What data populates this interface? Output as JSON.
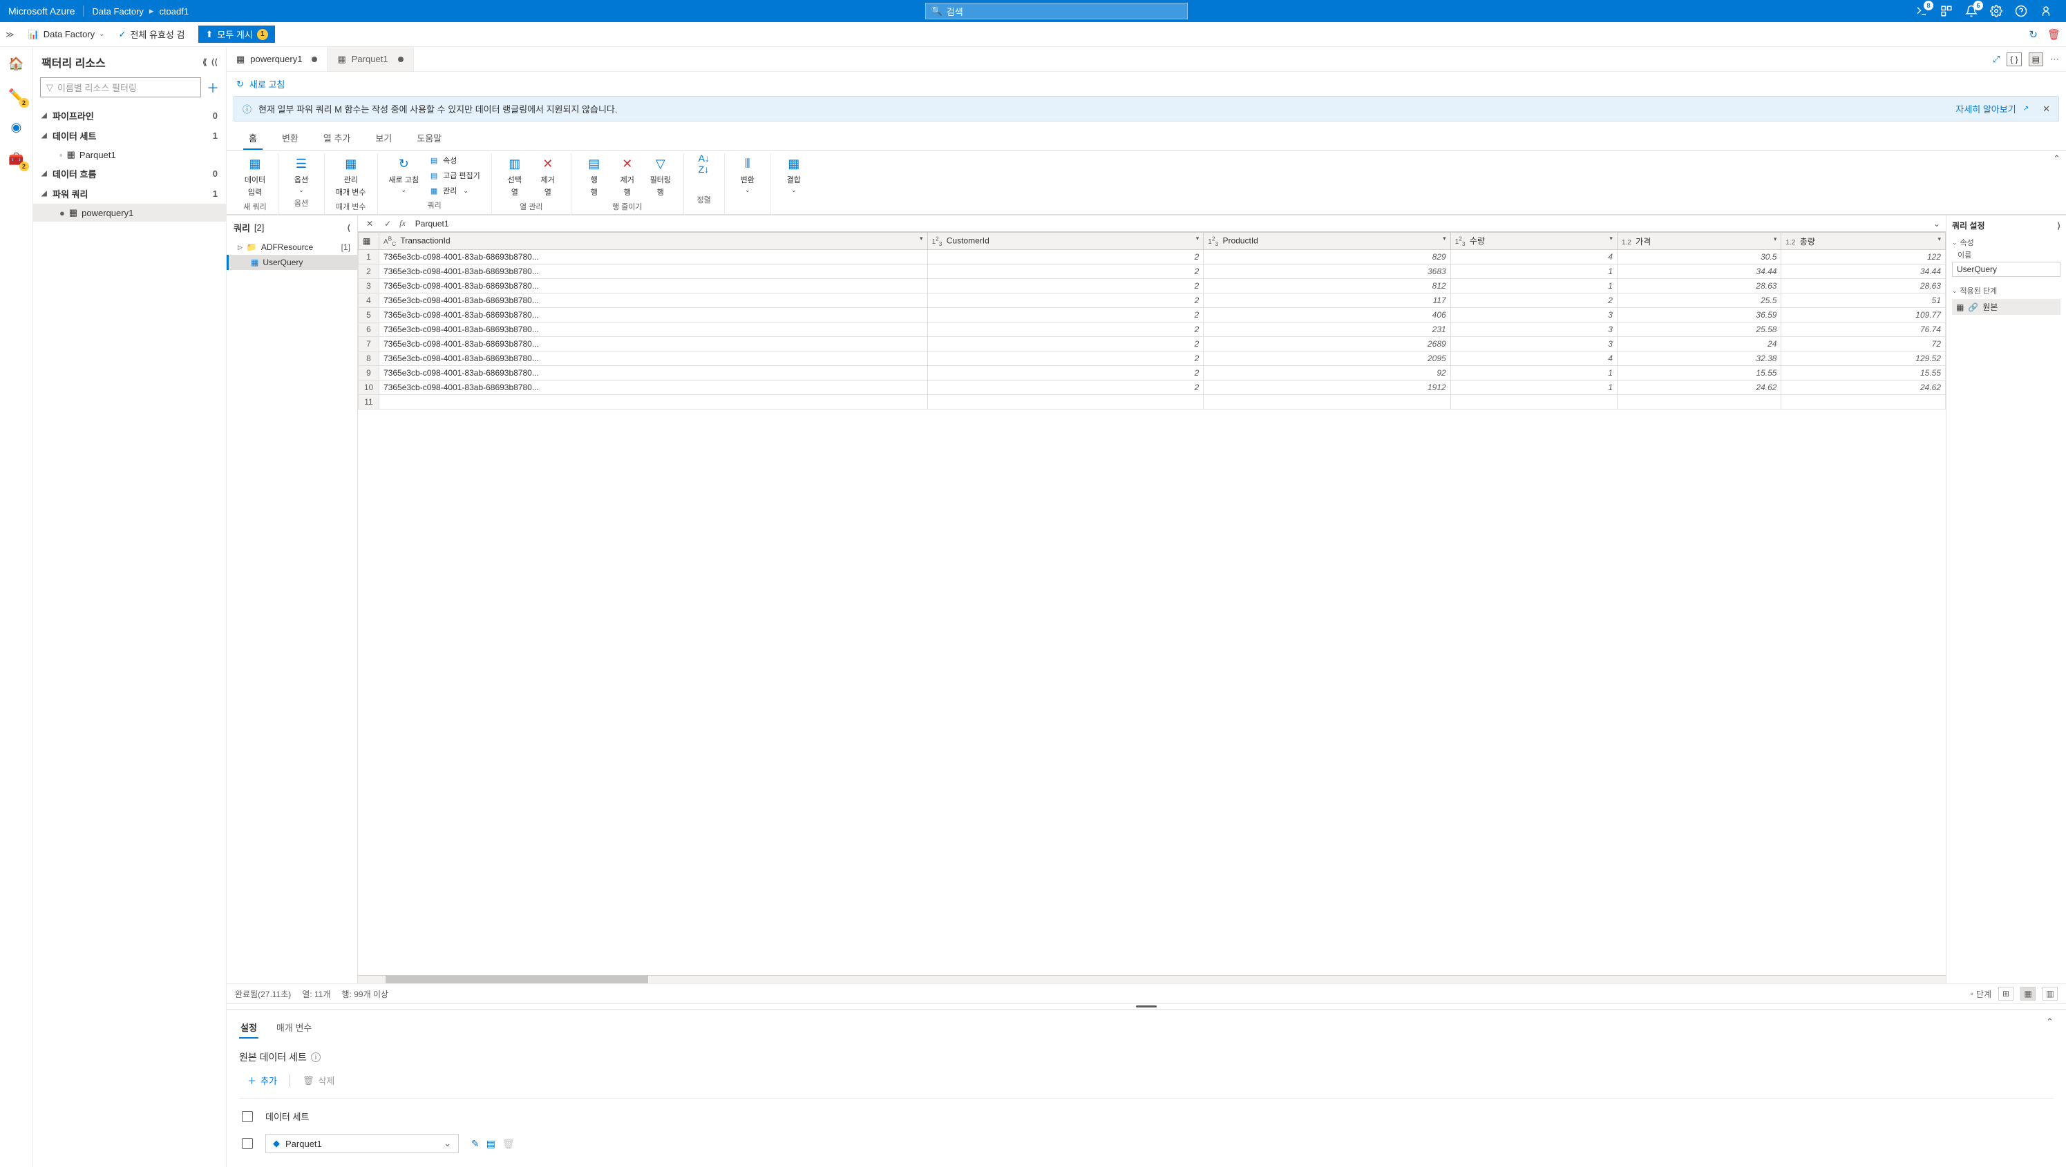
{
  "header": {
    "brand": "Microsoft Azure",
    "breadcrumb": [
      "Data Factory",
      "ctoadf1"
    ],
    "search_placeholder": "검색",
    "badges": {
      "notif": "8",
      "bell": "6"
    }
  },
  "toolbar": {
    "service_label": "Data Factory",
    "validate_label": "전체 유효성 검",
    "publish_label": "모두 게시",
    "publish_count": "1"
  },
  "rail": {
    "pencil_badge": "2",
    "toolbox_badge": "2"
  },
  "sidebar": {
    "title": "팩터리 리소스",
    "filter_placeholder": "이름별 리소스 필터링",
    "sections": [
      {
        "label": "파이프라인",
        "count": 0
      },
      {
        "label": "데이터 세트",
        "count": 1,
        "children": [
          {
            "label": "Parquet1"
          }
        ]
      },
      {
        "label": "데이터 흐름",
        "count": 0
      },
      {
        "label": "파워 쿼리",
        "count": 1,
        "children": [
          {
            "label": "powerquery1",
            "selected": true
          }
        ]
      }
    ]
  },
  "tabs": [
    {
      "label": "powerquery1",
      "dirty": true,
      "active": true,
      "icon": "pq"
    },
    {
      "label": "Parquet1",
      "dirty": true,
      "active": false,
      "icon": "ds"
    }
  ],
  "refresh_label": "새로 고침",
  "info_bar": {
    "msg": "현재 일부 파워 쿼리 M 함수는 작성 중에 사용할 수 있지만 데이터 랭글링에서 지원되지 않습니다.",
    "learn": "자세히 알아보기"
  },
  "pq_tabs": [
    "홈",
    "변환",
    "열 추가",
    "보기",
    "도움말"
  ],
  "ribbon_groups": [
    {
      "label": "새 쿼리",
      "buttons": [
        {
          "l1": "데이터",
          "l2": "입력"
        }
      ]
    },
    {
      "label": "옵션",
      "buttons": [
        {
          "l1": "옵션",
          "l2": ""
        }
      ]
    },
    {
      "label": "매개 변수",
      "buttons": [
        {
          "l1": "관리",
          "l2": "매개 변수"
        }
      ]
    },
    {
      "label": "쿼리",
      "buttons": [
        {
          "l1": "새로 고침",
          "l2": ""
        }
      ],
      "small": [
        "속성",
        "고급 편집기",
        "관리"
      ]
    },
    {
      "label": "열 관리",
      "buttons": [
        {
          "l1": "선택",
          "l2": "열"
        },
        {
          "l1": "제거",
          "l2": "열"
        }
      ]
    },
    {
      "label": "행 줄이기",
      "buttons": [
        {
          "l1": "행",
          "l2": "행"
        },
        {
          "l1": "제거",
          "l2": "행"
        },
        {
          "l1": "필터링",
          "l2": "행"
        }
      ]
    },
    {
      "label": "정렬",
      "buttons": [
        {
          "l1": "",
          "l2": ""
        }
      ]
    },
    {
      "label": "",
      "buttons": [
        {
          "l1": "변환",
          "l2": ""
        }
      ]
    },
    {
      "label": "",
      "buttons": [
        {
          "l1": "결합",
          "l2": ""
        }
      ]
    }
  ],
  "queries_panel": {
    "title": "쿼리",
    "count": "[2]",
    "items": [
      {
        "label": "ADFResource",
        "count": "[1]",
        "type": "folder"
      },
      {
        "label": "UserQuery",
        "type": "table",
        "selected": true
      }
    ]
  },
  "fx_value": "Parquet1",
  "grid": {
    "columns": [
      {
        "type": "ABC",
        "name": "TransactionId"
      },
      {
        "type": "123",
        "name": "CustomerId"
      },
      {
        "type": "123",
        "name": "ProductId"
      },
      {
        "type": "123",
        "name": "수량"
      },
      {
        "type": "1.2",
        "name": "가격"
      },
      {
        "type": "1.2",
        "name": "총량"
      }
    ],
    "rows": [
      [
        "7365e3cb-c098-4001-83ab-68693b8780...",
        "2",
        "829",
        "4",
        "30.5",
        "122"
      ],
      [
        "7365e3cb-c098-4001-83ab-68693b8780...",
        "2",
        "3683",
        "1",
        "34.44",
        "34.44"
      ],
      [
        "7365e3cb-c098-4001-83ab-68693b8780...",
        "2",
        "812",
        "1",
        "28.63",
        "28.63"
      ],
      [
        "7365e3cb-c098-4001-83ab-68693b8780...",
        "2",
        "117",
        "2",
        "25.5",
        "51"
      ],
      [
        "7365e3cb-c098-4001-83ab-68693b8780...",
        "2",
        "406",
        "3",
        "36.59",
        "109.77"
      ],
      [
        "7365e3cb-c098-4001-83ab-68693b8780...",
        "2",
        "231",
        "3",
        "25.58",
        "76.74"
      ],
      [
        "7365e3cb-c098-4001-83ab-68693b8780...",
        "2",
        "2689",
        "3",
        "24",
        "72"
      ],
      [
        "7365e3cb-c098-4001-83ab-68693b8780...",
        "2",
        "2095",
        "4",
        "32.38",
        "129.52"
      ],
      [
        "7365e3cb-c098-4001-83ab-68693b8780...",
        "2",
        "92",
        "1",
        "15.55",
        "15.55"
      ],
      [
        "7365e3cb-c098-4001-83ab-68693b8780...",
        "2",
        "1912",
        "1",
        "24.62",
        "24.62"
      ]
    ]
  },
  "query_settings": {
    "title": "쿼리 설정",
    "props_label": "속성",
    "name_label": "이름",
    "name_value": "UserQuery",
    "steps_label": "적용된 단계",
    "step1": "원본"
  },
  "status": {
    "done": "완료됨(27.11초)",
    "cols": "열: 11개",
    "rows": "행: 99개 이상",
    "step_btn": "단계"
  },
  "bottom": {
    "tabs": [
      "설정",
      "매개 변수"
    ],
    "section": "원본 데이터 세트",
    "add": "추가",
    "delete": "삭제",
    "ds_header": "데이터 세트",
    "ds_value": "Parquet1"
  }
}
